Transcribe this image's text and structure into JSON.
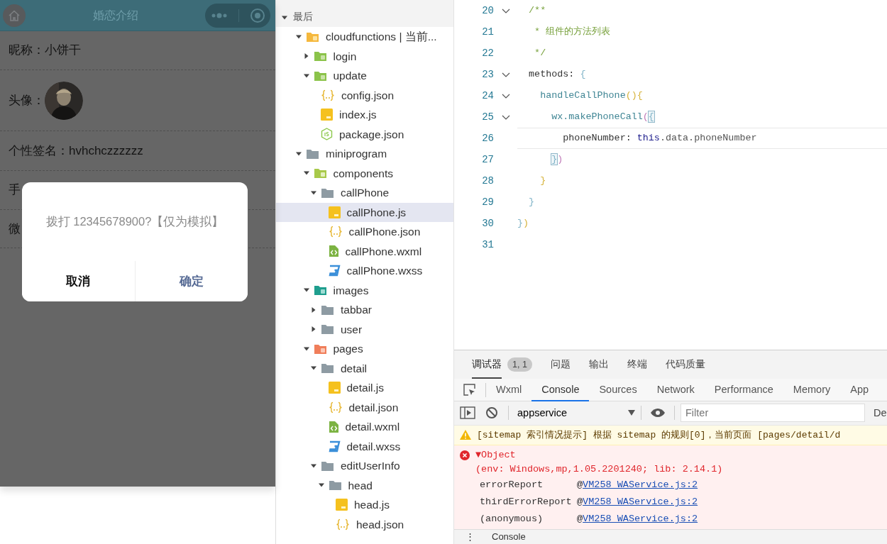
{
  "simulator": {
    "nav_title": "婚恋介绍",
    "profile_rows": [
      {
        "kind": "text",
        "text": "昵称：小饼干"
      },
      {
        "kind": "avatar",
        "text": "头像："
      },
      {
        "kind": "text",
        "text": "个性签名：hvhchczzzzzz"
      },
      {
        "kind": "text",
        "text": "手"
      },
      {
        "kind": "text",
        "text": "微"
      }
    ],
    "dialog": {
      "message": "拨打 12345678900?【仅为模拟】",
      "cancel": "取消",
      "confirm": "确定"
    }
  },
  "explorer": {
    "section": {
      "label": "最后",
      "expanded": true
    },
    "tree": [
      {
        "label": "cloudfunctions | 当前...",
        "kind": "cloud-folder",
        "expanded": true,
        "selected": false,
        "children": [
          {
            "label": "login",
            "kind": "function-folder",
            "expanded": false,
            "selected": false
          },
          {
            "label": "update",
            "kind": "function-folder",
            "expanded": true,
            "selected": false,
            "children": [
              {
                "label": "config.json",
                "kind": "json",
                "selected": false
              },
              {
                "label": "index.js",
                "kind": "js",
                "selected": false
              },
              {
                "label": "package.json",
                "kind": "node",
                "selected": false
              }
            ]
          }
        ]
      },
      {
        "label": "miniprogram",
        "kind": "folder",
        "expanded": true,
        "selected": false,
        "children": [
          {
            "label": "components",
            "kind": "components-folder",
            "expanded": true,
            "selected": false,
            "children": [
              {
                "label": "callPhone",
                "kind": "folder",
                "expanded": true,
                "selected": false,
                "children": [
                  {
                    "label": "callPhone.js",
                    "kind": "js",
                    "selected": true
                  },
                  {
                    "label": "callPhone.json",
                    "kind": "json",
                    "selected": false
                  },
                  {
                    "label": "callPhone.wxml",
                    "kind": "wxml",
                    "selected": false
                  },
                  {
                    "label": "callPhone.wxss",
                    "kind": "wxss",
                    "selected": false
                  }
                ]
              }
            ]
          },
          {
            "label": "images",
            "kind": "images-folder",
            "expanded": true,
            "selected": false,
            "children": [
              {
                "label": "tabbar",
                "kind": "folder",
                "expanded": false,
                "selected": false
              },
              {
                "label": "user",
                "kind": "folder",
                "expanded": false,
                "selected": false
              }
            ]
          },
          {
            "label": "pages",
            "kind": "pages-folder",
            "expanded": true,
            "selected": false,
            "children": [
              {
                "label": "detail",
                "kind": "folder",
                "expanded": true,
                "selected": false,
                "children": [
                  {
                    "label": "detail.js",
                    "kind": "js",
                    "selected": false
                  },
                  {
                    "label": "detail.json",
                    "kind": "json",
                    "selected": false
                  },
                  {
                    "label": "detail.wxml",
                    "kind": "wxml",
                    "selected": false
                  },
                  {
                    "label": "detail.wxss",
                    "kind": "wxss",
                    "selected": false
                  }
                ]
              },
              {
                "label": "editUserInfo",
                "kind": "folder",
                "expanded": true,
                "selected": false,
                "children": [
                  {
                    "label": "head",
                    "kind": "folder",
                    "expanded": true,
                    "selected": false,
                    "children": [
                      {
                        "label": "head.js",
                        "kind": "js",
                        "selected": false
                      },
                      {
                        "label": "head.json",
                        "kind": "json",
                        "selected": false
                      }
                    ]
                  }
                ]
              }
            ]
          }
        ]
      }
    ]
  },
  "editor": {
    "lines": [
      {
        "number": "20",
        "fold": true,
        "current": false,
        "tokens": [
          {
            "text": "  /**",
            "kind": "comment"
          }
        ]
      },
      {
        "number": "21",
        "fold": false,
        "current": false,
        "tokens": [
          {
            "text": "   * 组件的方法列表",
            "kind": "comment"
          }
        ]
      },
      {
        "number": "22",
        "fold": false,
        "current": false,
        "tokens": [
          {
            "text": "   */",
            "kind": "comment"
          }
        ]
      },
      {
        "number": "23",
        "fold": true,
        "current": false,
        "tokens": [
          {
            "text": "  methods: ",
            "kind": "plain"
          },
          {
            "text": "{",
            "kind": "brace-blue"
          }
        ]
      },
      {
        "number": "24",
        "fold": true,
        "current": false,
        "tokens": [
          {
            "text": "    handleCallPhone",
            "kind": "function"
          },
          {
            "text": "(){",
            "kind": "brace-yellow"
          }
        ]
      },
      {
        "number": "25",
        "fold": true,
        "current": false,
        "tokens": [
          {
            "text": "      wx.makePhoneCall",
            "kind": "function"
          },
          {
            "text": "(",
            "kind": "brace-pink"
          },
          {
            "text": "{",
            "kind": "brace-match"
          }
        ]
      },
      {
        "number": "26",
        "fold": false,
        "current": true,
        "tokens": [
          {
            "text": "        phoneNumber: ",
            "kind": "plain"
          },
          {
            "text": "this",
            "kind": "keyword"
          },
          {
            "text": ".data.phoneNumber",
            "kind": "member"
          }
        ]
      },
      {
        "number": "27",
        "fold": false,
        "current": false,
        "tokens": [
          {
            "text": "      }",
            "kind": "brace-match"
          },
          {
            "text": ")",
            "kind": "brace-pink"
          }
        ]
      },
      {
        "number": "28",
        "fold": false,
        "current": false,
        "tokens": [
          {
            "text": "    }",
            "kind": "brace-yellow"
          }
        ]
      },
      {
        "number": "29",
        "fold": false,
        "current": false,
        "tokens": [
          {
            "text": "  }",
            "kind": "brace-blue"
          }
        ]
      },
      {
        "number": "30",
        "fold": false,
        "current": false,
        "tokens": [
          {
            "text": "}",
            "kind": "brace-blue"
          },
          {
            "text": ")",
            "kind": "brace-yellow"
          }
        ]
      },
      {
        "number": "31",
        "fold": false,
        "current": false
      }
    ]
  },
  "devtools": {
    "panel_tabs": [
      {
        "label": "调试器",
        "selected": true,
        "badge": "1, 1"
      },
      {
        "label": "问题",
        "selected": false
      },
      {
        "label": "输出",
        "selected": false
      },
      {
        "label": "终端",
        "selected": false
      },
      {
        "label": "代码质量",
        "selected": false
      }
    ],
    "tool_tabs": [
      {
        "label": "Wxml",
        "selected": false
      },
      {
        "label": "Console",
        "selected": true
      },
      {
        "label": "Sources",
        "selected": false
      },
      {
        "label": "Network",
        "selected": false
      },
      {
        "label": "Performance",
        "selected": false
      },
      {
        "label": "Memory",
        "selected": false
      },
      {
        "label": "App",
        "selected": false
      }
    ],
    "context": "appservice",
    "filter": {
      "placeholder": "Filter"
    },
    "levels": "De",
    "messages": [
      {
        "kind": "warning",
        "text": "[sitemap 索引情况提示] 根据 sitemap 的规则[0]，当前页面 [pages/detail/d"
      },
      {
        "kind": "error",
        "title": "▼Object",
        "detail": "(env: Windows,mp,1.05.2201240; lib: 2.14.1)",
        "stack": [
          {
            "function": "errorReport",
            "at": "@",
            "source": "VM258 WAService.js:2"
          },
          {
            "function": "thirdErrorReport",
            "at": "@",
            "source": "VM258 WAService.js:2"
          },
          {
            "function": "(anonymous)",
            "at": "@",
            "source": "VM258 WAService.js:2"
          }
        ]
      }
    ],
    "drawer": {
      "menu": "⋮",
      "tab": "Console"
    }
  }
}
